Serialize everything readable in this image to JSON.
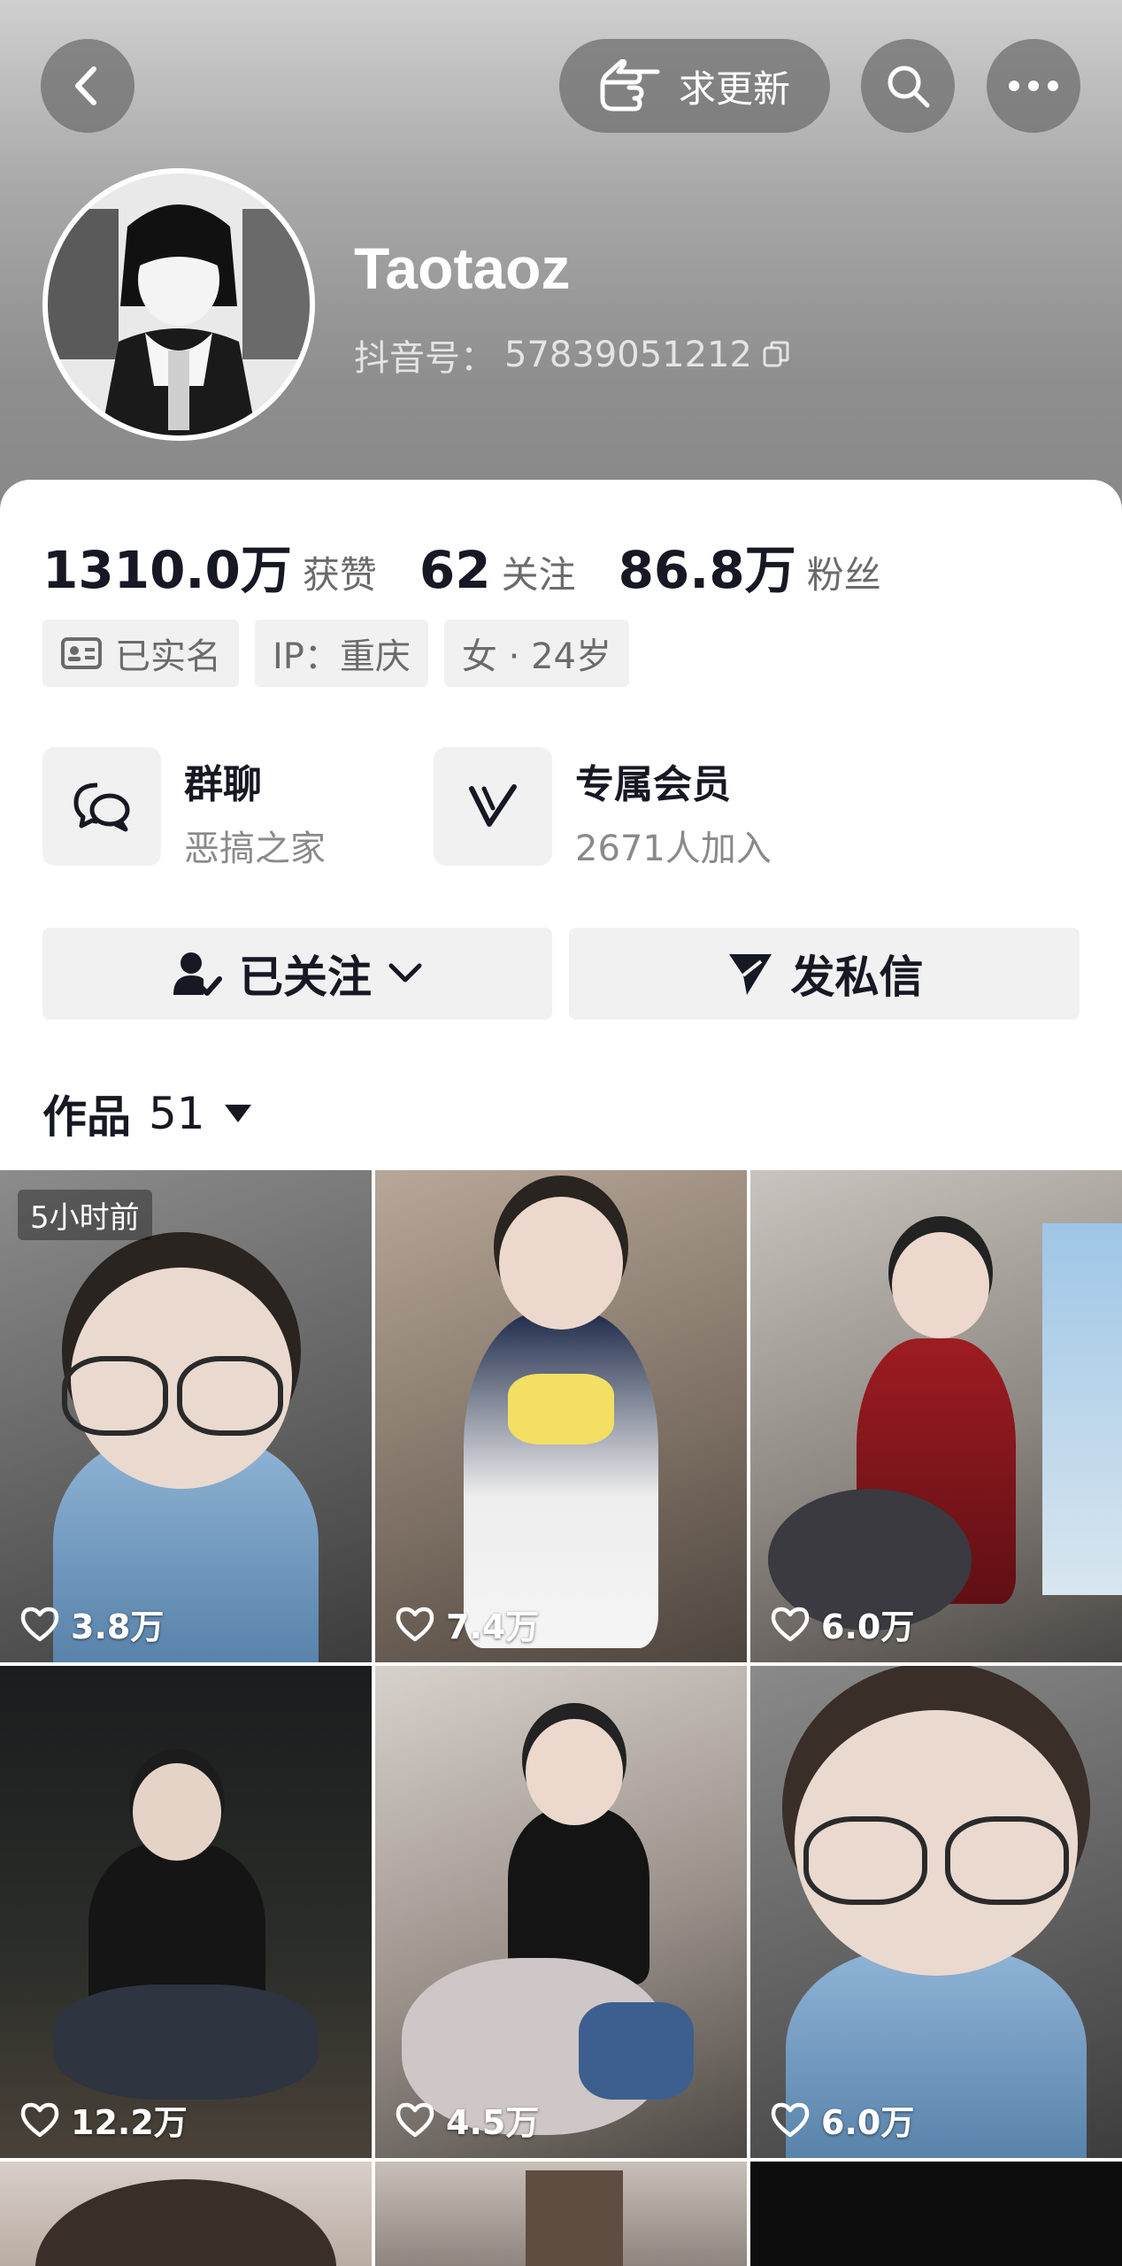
{
  "header": {
    "update_label": "求更新",
    "nickname": "Taotaoz",
    "douyin_id_label": "抖音号：",
    "douyin_id": "57839051212"
  },
  "stats": [
    {
      "num": "1310.0万",
      "label": "获赞"
    },
    {
      "num": "62",
      "label": "关注"
    },
    {
      "num": "86.8万",
      "label": "粉丝"
    }
  ],
  "tags": {
    "verified": "已实名",
    "ip": "IP：重庆",
    "gender_age": "女 · 24岁"
  },
  "features": {
    "group": {
      "title": "群聊",
      "subtitle": "恶搞之家"
    },
    "member": {
      "title": "专属会员",
      "subtitle": "2671人加入"
    }
  },
  "actions": {
    "follow": "已关注",
    "message": "发私信"
  },
  "works": {
    "label": "作品",
    "count": "51"
  },
  "videos": [
    {
      "likes": "3.8万",
      "badge": "5小时前"
    },
    {
      "likes": "7.4万"
    },
    {
      "likes": "6.0万"
    },
    {
      "likes": "12.2万"
    },
    {
      "likes": "4.5万"
    },
    {
      "likes": "6.0万"
    }
  ],
  "colors": {
    "header_gray": "#8f8f8f",
    "button_gray": "#f1f1f2",
    "text_primary": "#161823",
    "text_secondary": "#6b6b6b"
  },
  "icons": [
    "back-icon",
    "pointing-hand-icon",
    "search-icon",
    "more-icon",
    "copy-icon",
    "id-card-icon",
    "chat-bubbles-icon",
    "v-member-icon",
    "user-check-icon",
    "chevron-down-icon",
    "send-icon",
    "caret-down-icon",
    "heart-icon"
  ]
}
